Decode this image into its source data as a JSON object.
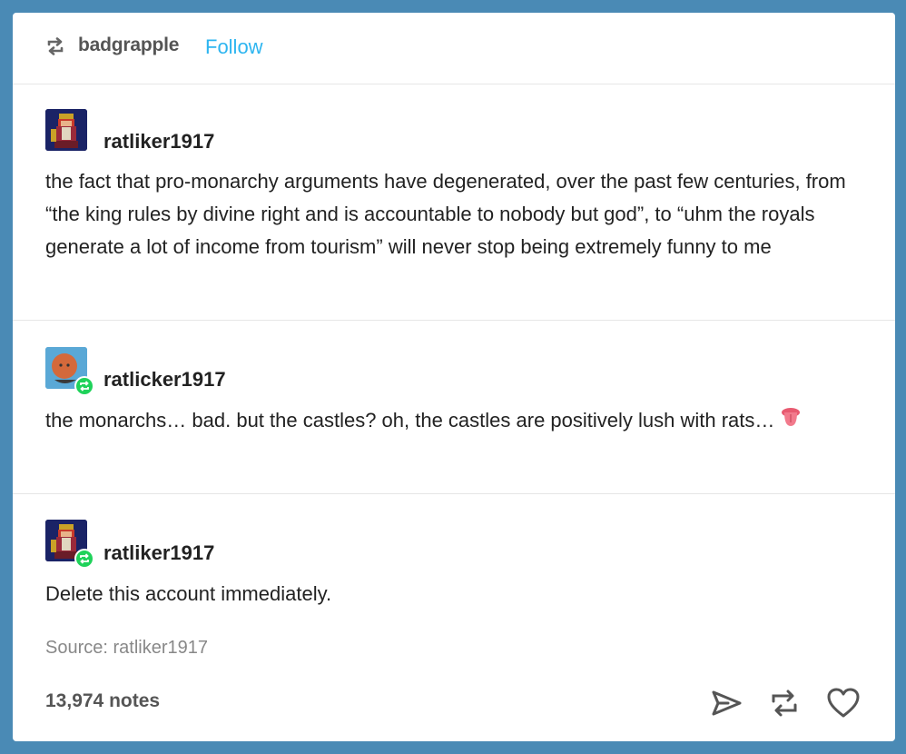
{
  "header": {
    "reblogger": "badgrapple",
    "follow_label": "Follow"
  },
  "posts": [
    {
      "username": "ratliker1917",
      "text": "the fact that pro-monarchy arguments have degenerated, over the past few centuries, from “the king rules by divine right and is accountable to nobody but god”, to “uhm the royals generate a lot of income from tourism” will never stop being extremely funny to me"
    },
    {
      "username": "ratlicker1917",
      "text": "the monarchs… bad. but the castles? oh, the castles are positively lush with rats…",
      "emoji": "tongue-emoji"
    },
    {
      "username": "ratliker1917",
      "text": "Delete this account immediately."
    }
  ],
  "footer": {
    "source": "Source: ratliker1917",
    "notes": "13,974 notes"
  },
  "icons": {
    "reblog": "reblog-icon",
    "share": "share-icon",
    "like": "heart-icon"
  },
  "colors": {
    "background": "#4a8ab5",
    "follow": "#2db5f0",
    "reblog_badge": "#1fd25a"
  }
}
